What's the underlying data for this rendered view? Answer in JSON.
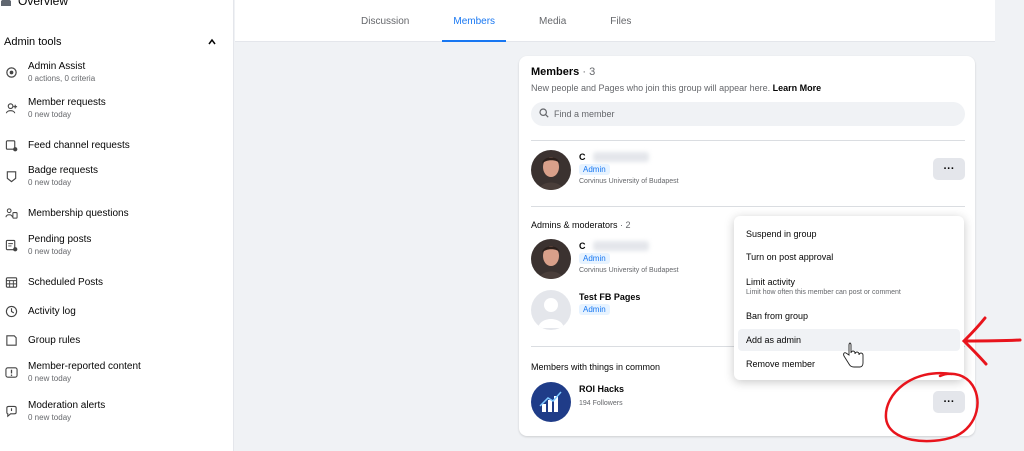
{
  "sidebar": {
    "overview_label": "Overview",
    "section_title": "Admin tools",
    "items": [
      {
        "label": "Admin Assist",
        "sub": "0 actions, 0 criteria",
        "icon": "gear-icon"
      },
      {
        "label": "Member requests",
        "sub": "0 new today",
        "icon": "add-person-icon"
      },
      {
        "label": "Feed channel requests",
        "sub": "",
        "icon": "feed-icon"
      },
      {
        "label": "Badge requests",
        "sub": "0 new today",
        "icon": "badge-icon"
      },
      {
        "label": "Membership questions",
        "sub": "",
        "icon": "questions-icon"
      },
      {
        "label": "Pending posts",
        "sub": "0 new today",
        "icon": "pending-posts-icon"
      },
      {
        "label": "Scheduled Posts",
        "sub": "",
        "icon": "calendar-icon"
      },
      {
        "label": "Activity log",
        "sub": "",
        "icon": "clock-icon"
      },
      {
        "label": "Group rules",
        "sub": "",
        "icon": "rules-icon"
      },
      {
        "label": "Member-reported content",
        "sub": "0 new today",
        "icon": "report-icon"
      },
      {
        "label": "Moderation alerts",
        "sub": "0 new today",
        "icon": "alert-icon"
      }
    ]
  },
  "tabs": [
    {
      "label": "Discussion",
      "active": false
    },
    {
      "label": "Members",
      "active": true
    },
    {
      "label": "Media",
      "active": false
    },
    {
      "label": "Files",
      "active": false
    }
  ],
  "members_card": {
    "title": "Members",
    "count": " · 3",
    "description": "New people and Pages who join this group will appear here.",
    "learn_more": "Learn More",
    "search_placeholder": "Find a member",
    "top_member": {
      "name": "C",
      "badge": "Admin",
      "sub": "Corvinus University of Budapest"
    },
    "admins_title": "Admins & moderators",
    "admins_count": " · 2",
    "admins": [
      {
        "name": "C",
        "badge": "Admin",
        "sub": "Corvinus University of Budapest"
      },
      {
        "name": "Test FB Pages",
        "badge": "Admin",
        "sub": ""
      }
    ],
    "common_title": "Members with things in common",
    "common_member": {
      "name": "ROI Hacks",
      "sub": "194 Followers"
    },
    "more_label": "···"
  },
  "dropdown": {
    "items": [
      {
        "label": "Suspend in group",
        "sub": ""
      },
      {
        "label": "Turn on post approval",
        "sub": ""
      },
      {
        "label": "Limit activity",
        "sub": "Limit how often this member can post or comment"
      },
      {
        "label": "Ban from group",
        "sub": ""
      },
      {
        "label": "Add as admin",
        "sub": ""
      },
      {
        "label": "Remove member",
        "sub": ""
      }
    ]
  },
  "colors": {
    "accent": "#1877f2",
    "annotation": "#e8141c"
  }
}
